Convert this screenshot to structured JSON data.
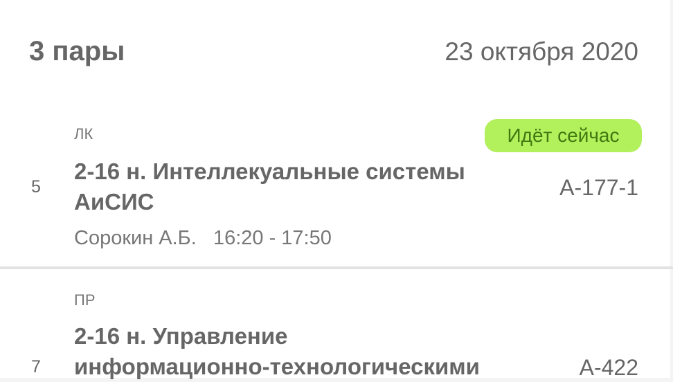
{
  "header": {
    "title": "3 пары",
    "date": "23 октября 2020"
  },
  "lessons": [
    {
      "type": "ЛК",
      "number": "5",
      "subject_line1": "2-16 н. Интеллекуальные системы",
      "subject_line2": "АиСИС",
      "room": "А-177-1",
      "teacher": "Сорокин А.Б.",
      "time": "16:20 - 17:50",
      "badge": "Идёт сейчас"
    },
    {
      "type": "ПР",
      "number": "7",
      "subject_line1": "2-16 н. Управление",
      "subject_line2": "информационно-технологическими",
      "room": "А-422"
    }
  ],
  "colors": {
    "badge_bg": "#b2f05c",
    "badge_text": "#3f7a12"
  }
}
